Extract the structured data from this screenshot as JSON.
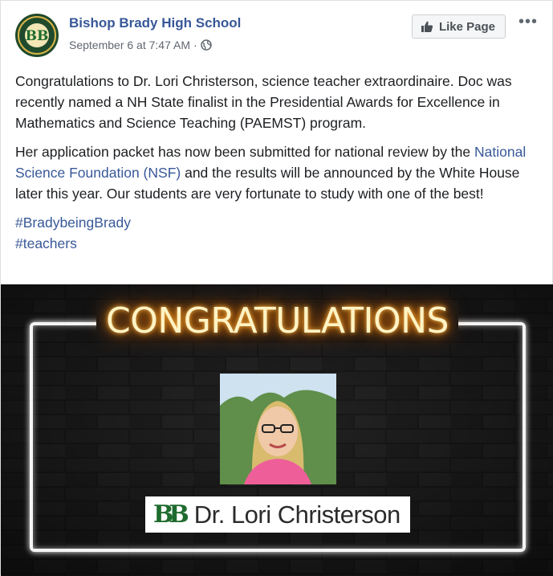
{
  "page": {
    "name": "Bishop Brady High School",
    "logo_text": "HOME OF THE GIANTS",
    "logo_initials": "BB",
    "timestamp": "September 6 at 7:47 AM",
    "separator": "·",
    "visibility_icon": "globe-icon"
  },
  "actions": {
    "like_page_label": "Like Page",
    "like_icon": "thumbs-up-icon",
    "more_label": "•••"
  },
  "post": {
    "paragraph1": "Congratulations to Dr. Lori Christerson, science teacher extraordinaire. Doc was recently named a NH State finalist in the Presidential Awards for Excellence in Mathematics and Science Teaching (PAEMST) program.",
    "paragraph2_before": "Her application packet has now been submitted for national review by the ",
    "paragraph2_link": "National Science Foundation (NSF)",
    "paragraph2_after": " and the results will be announced by the White House later this year. Our students are very fortunate to study with one of the best!",
    "hashtags": [
      "#BradybeingBrady",
      "#teachers"
    ]
  },
  "image": {
    "headline": "CONGRATULATIONS",
    "nameplate_logo": "BB",
    "nameplate_name": "Dr. Lori Christerson"
  },
  "colors": {
    "link": "#385898",
    "neon": "#ff8a00",
    "brand_green": "#1e6b2e"
  }
}
